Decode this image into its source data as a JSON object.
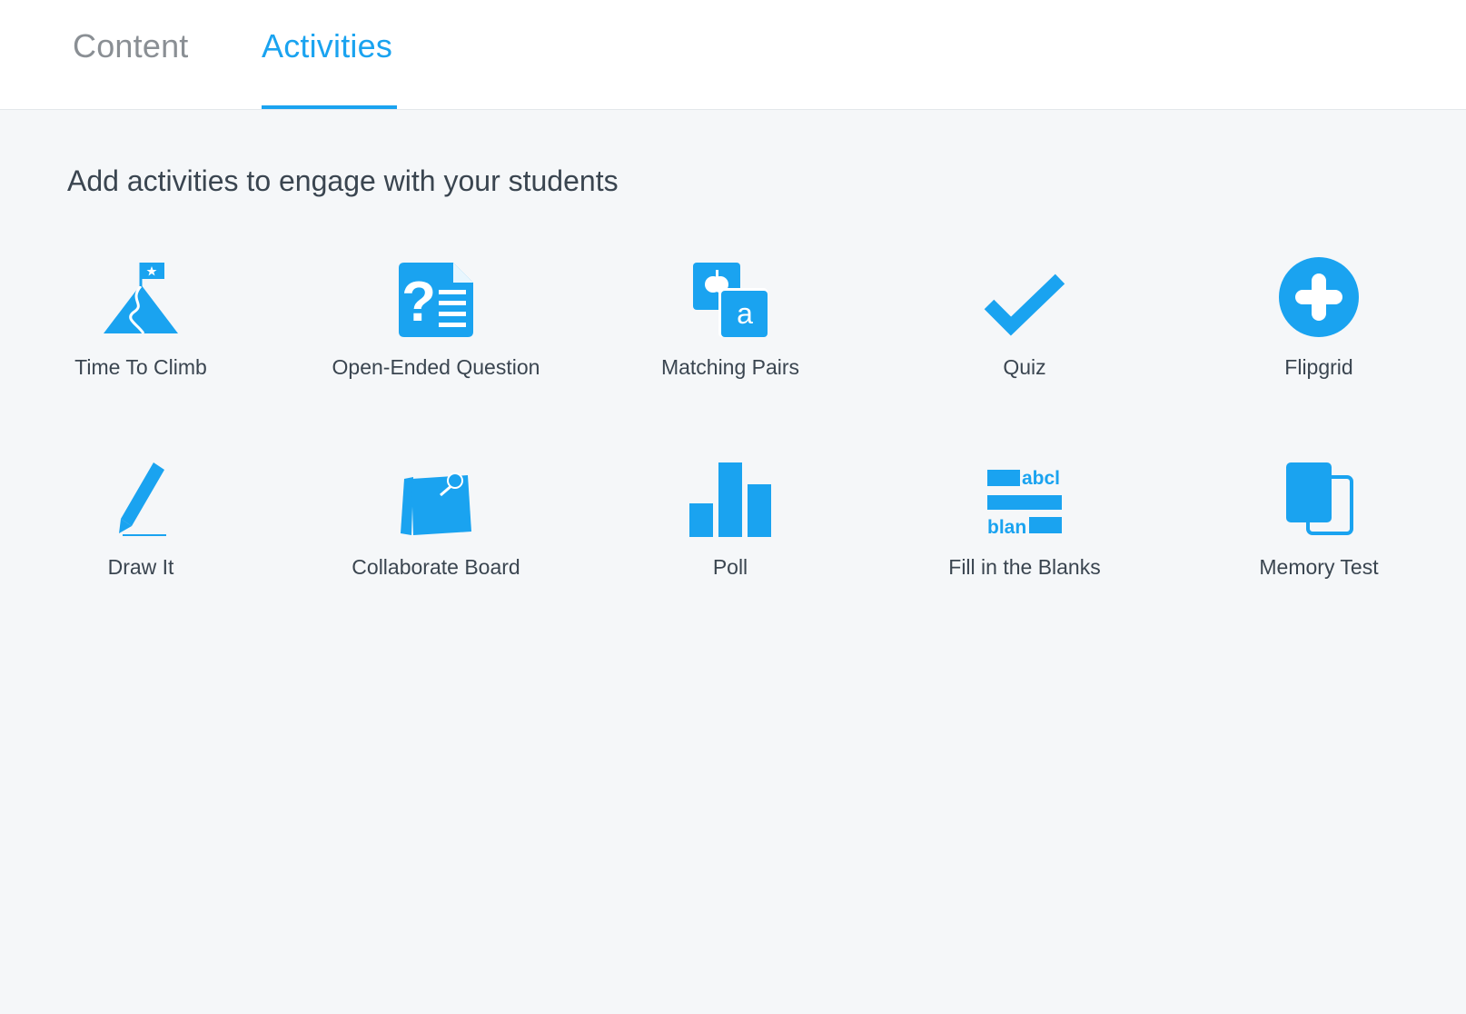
{
  "tabs": [
    {
      "label": "Content",
      "active": false
    },
    {
      "label": "Activities",
      "active": true
    }
  ],
  "heading": "Add activities to engage with your students",
  "accent_color": "#1aa3f0",
  "activities": [
    {
      "label": "Time To Climb",
      "icon": "mountain-flag-icon"
    },
    {
      "label": "Open-Ended Question",
      "icon": "question-document-icon"
    },
    {
      "label": "Matching Pairs",
      "icon": "matching-cards-icon"
    },
    {
      "label": "Quiz",
      "icon": "checkmark-icon"
    },
    {
      "label": "Flipgrid",
      "icon": "plus-circle-icon"
    },
    {
      "label": "Draw It",
      "icon": "pencil-icon"
    },
    {
      "label": "Collaborate Board",
      "icon": "sticky-note-pin-icon"
    },
    {
      "label": "Poll",
      "icon": "bar-chart-icon"
    },
    {
      "label": "Fill in the Blanks",
      "icon": "fill-blanks-icon",
      "icon_text": [
        "abcl",
        "blan"
      ]
    },
    {
      "label": "Memory Test",
      "icon": "memory-cards-icon"
    }
  ]
}
